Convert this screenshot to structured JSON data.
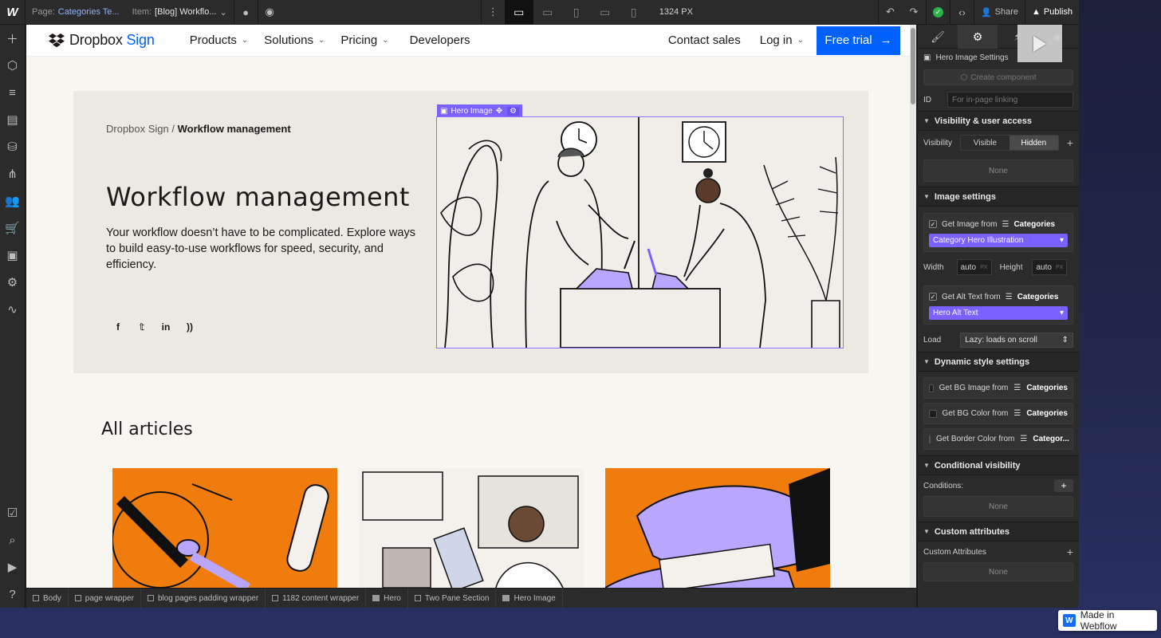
{
  "topbar": {
    "page_label": "Page:",
    "page_value": "Categories Te...",
    "item_label": "Item:",
    "item_value": "[Blog] Workflo...",
    "width_readout": "1324 PX",
    "share_label": "Share",
    "publish_label": "Publish"
  },
  "site": {
    "brand_name": "Dropbox",
    "brand_sign": "Sign",
    "nav": [
      "Products",
      "Solutions",
      "Pricing",
      "Developers"
    ],
    "contact_sales": "Contact sales",
    "log_in": "Log in",
    "free_trial": "Free trial",
    "breadcrumb_root": "Dropbox Sign /",
    "breadcrumb_current": "Workflow management",
    "hero_title": "Workflow management",
    "hero_description": "Your workflow doesn’t have to be complicated. Explore ways to build easy-to-use workflows for speed, security, and efficiency.",
    "all_articles": "All articles",
    "social_icons": [
      "facebook-icon",
      "twitter-icon",
      "linkedin-icon",
      "rss-icon"
    ]
  },
  "selection": {
    "tag_label": "Hero Image"
  },
  "breadcrumbs": [
    "Body",
    "page wrapper",
    "blog pages padding wrapper",
    "1182 content wrapper",
    "Hero",
    "Two Pane Section",
    "Hero Image"
  ],
  "panel": {
    "element_label": "Hero Image Settings",
    "create_component": "Create component",
    "id_label": "ID",
    "id_placeholder": "For in-page linking",
    "visibility_section": "Visibility & user access",
    "visibility_label": "Visibility",
    "visible": "Visible",
    "hidden": "Hidden",
    "visibility_none": "None",
    "image_section": "Image settings",
    "get_image_from": "Get Image from",
    "categories": "Categories",
    "image_field": "Category Hero Illustration",
    "width_label": "Width",
    "width_value": "auto",
    "height_label": "Height",
    "height_value": "auto",
    "unit": "PX",
    "get_alt_from": "Get Alt Text from",
    "alt_field": "Hero Alt Text",
    "load_label": "Load",
    "load_value": "Lazy: loads on scroll",
    "dynamic_section": "Dynamic style settings",
    "bg_image": "Get BG Image from",
    "bg_color": "Get BG Color from",
    "border_color": "Get Border Color from",
    "categories_trunc": "Categor...",
    "conditional_section": "Conditional visibility",
    "conditions_label": "Conditions:",
    "conditions_none": "None",
    "custom_section": "Custom attributes",
    "custom_label": "Custom Attributes",
    "custom_none": "None"
  },
  "badge": {
    "made_in": "Made in Webflow"
  },
  "colors": {
    "accent_purple": "#7b61ff",
    "dropbox_blue": "#0061fe",
    "card_orange": "#f07c0e",
    "success_green": "#2cb34a"
  }
}
